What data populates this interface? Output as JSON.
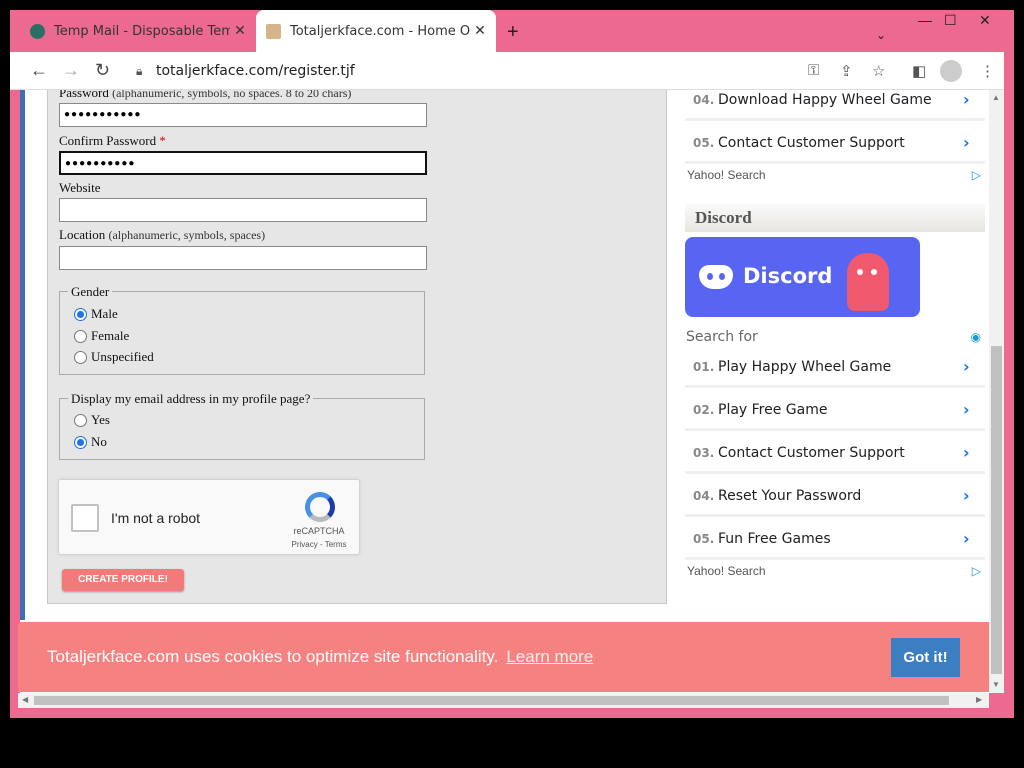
{
  "browser": {
    "tabs": [
      {
        "title": "Temp Mail - Disposable Tempora",
        "close": "✕",
        "favicon_color": "#2a6f63"
      },
      {
        "title": "Totaljerkface.com - Home Of Hap",
        "close": "✕",
        "favicon_color": "#d6b48a"
      }
    ],
    "new_tab": "+",
    "url": "totaljerkface.com/register.tjf",
    "window_controls": {
      "minimize": "—",
      "maximize": "☐",
      "close": "✕"
    }
  },
  "form": {
    "password_label": "Password",
    "password_hint": "(alphanumeric, symbols, no spaces. 8 to 20 chars)",
    "password_value": "●●●●●●●●●●●",
    "confirm_label": "Confirm Password",
    "confirm_required": "*",
    "confirm_value": "●●●●●●●●●●",
    "website_label": "Website",
    "website_value": "",
    "location_label": "Location",
    "location_hint": "(alphanumeric, symbols, spaces)",
    "location_value": "",
    "gender": {
      "legend": "Gender",
      "options": [
        "Male",
        "Female",
        "Unspecified"
      ],
      "selected": "Male"
    },
    "display_email": {
      "legend": "Display my email address in my profile page?",
      "options": [
        "Yes",
        "No"
      ],
      "selected": "No"
    },
    "captcha": {
      "label": "I'm not a robot",
      "brand": "reCAPTCHA",
      "terms": "Privacy - Terms"
    },
    "submit_label": "CREATE PROFILE!"
  },
  "sidebar": {
    "top_list": [
      {
        "num": "04.",
        "text": "Download Happy Wheel Game"
      },
      {
        "num": "05.",
        "text": "Contact Customer Support"
      }
    ],
    "yahoo_label": "Yahoo! Search",
    "discord_heading": "Discord",
    "discord_banner_text": "Discord",
    "search_for_label": "Search for",
    "bottom_list": [
      {
        "num": "01.",
        "text": "Play Happy Wheel Game"
      },
      {
        "num": "02.",
        "text": "Play Free Game"
      },
      {
        "num": "03.",
        "text": "Contact Customer Support"
      },
      {
        "num": "04.",
        "text": "Reset Your Password"
      },
      {
        "num": "05.",
        "text": "Fun Free Games"
      }
    ],
    "yahoo_label_2": "Yahoo! Search"
  },
  "cookie": {
    "message": "Totaljerkface.com uses cookies to optimize site functionality.",
    "learn_more": "Learn more",
    "button": "Got it!"
  },
  "colors": {
    "window_frame": "#ec6a8f",
    "cookie_bar": "#f68181",
    "cookie_button": "#3b7fc2",
    "submit_button": "#f27a7a",
    "discord": "#5865f2"
  }
}
